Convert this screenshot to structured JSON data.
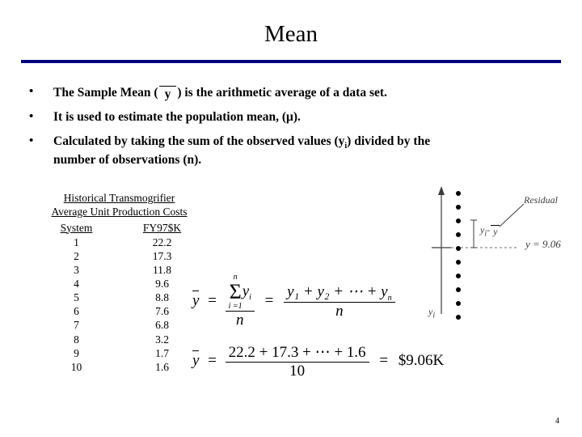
{
  "slide": {
    "title": "Mean",
    "page_number": "4",
    "bullets": [
      {
        "marker": "•",
        "pre": "The Sample Mean (",
        "overbar_symbol": "y",
        "post": ") is the arithmetic average of a data set."
      },
      {
        "marker": "•",
        "text": "It is used to estimate the population mean, (μ)."
      },
      {
        "marker": "•",
        "line1_pre": "Calculated by taking the sum of the observed values (y",
        "line1_sub": "i",
        "line1_post": ") divided by the",
        "line2": "number of observations (n)."
      }
    ],
    "table": {
      "caption_line1": "Historical Transmogrifier",
      "caption_line2": "Average Unit Production Costs",
      "columns": [
        "System",
        "FY97$K"
      ],
      "rows": [
        [
          "1",
          "22.2"
        ],
        [
          "2",
          "17.3"
        ],
        [
          "3",
          "11.8"
        ],
        [
          "4",
          "9.6"
        ],
        [
          "5",
          "8.8"
        ],
        [
          "6",
          "7.6"
        ],
        [
          "7",
          "6.8"
        ],
        [
          "8",
          "3.2"
        ],
        [
          "9",
          "1.7"
        ],
        [
          "10",
          "1.6"
        ]
      ]
    },
    "equation1": {
      "lhs": "y",
      "eq1": "=",
      "sigma_top": "n",
      "sigma_char": "Σ",
      "sigma_bottom": "i =1",
      "sigma_arg": "y",
      "sigma_arg_sub": "i",
      "denominator": "n",
      "eq2": "=",
      "numerator_terms": "y₁ + y₂ + ⋯ + y",
      "numerator_last_sub": "n",
      "denominator2": "n"
    },
    "equation2": {
      "lhs": "y",
      "eq1": "=",
      "numerator": "22.2 + 17.3 + ⋯ + 1.6",
      "denominator": "10",
      "eq2": "=",
      "result": "$9.06K"
    },
    "diagram": {
      "residual_label": "Residual",
      "residual_formula_left": "y",
      "residual_formula_sub": "i",
      "residual_formula_mid": "-",
      "residual_formula_right": "y",
      "mean_label": "y = 9.06",
      "axis_label": "y",
      "axis_label_sub": "i",
      "dot_count": 10
    }
  },
  "colors": {
    "rule": "#000080",
    "text": "#000000",
    "diagram_gray": "#3b3b3b"
  }
}
